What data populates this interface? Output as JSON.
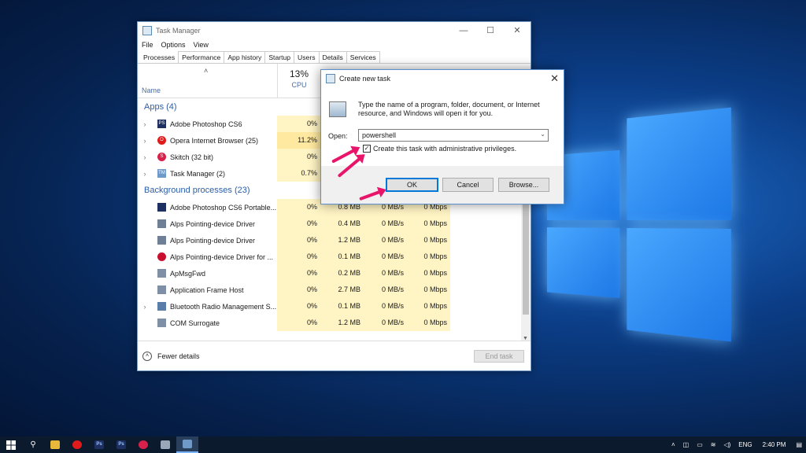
{
  "taskmanager": {
    "title": "Task Manager",
    "window_controls": [
      "—",
      "☐",
      "✕"
    ],
    "menu": [
      "File",
      "Options",
      "View"
    ],
    "tabs": [
      "Processes",
      "Performance",
      "App history",
      "Startup",
      "Users",
      "Details",
      "Services"
    ],
    "header": {
      "name": "Name",
      "cpu_pct": "13%",
      "cpu": "CPU"
    },
    "apps_group": "Apps (4)",
    "apps": [
      {
        "name": "Adobe Photoshop CS6",
        "cpu": "0%",
        "icon": "PS"
      },
      {
        "name": "Opera Internet Browser (25)",
        "cpu": "11.2%",
        "icon": "O"
      },
      {
        "name": "Skitch (32 bit)",
        "cpu": "0%",
        "icon": "S"
      },
      {
        "name": "Task Manager (2)",
        "cpu": "0.7%",
        "icon": "TM"
      }
    ],
    "bg_group": "Background processes (23)",
    "bg": [
      {
        "name": "Adobe Photoshop CS6 Portable...",
        "cpu": "0%",
        "mem": "0.8 MB",
        "disk": "0 MB/s",
        "net": "0 Mbps"
      },
      {
        "name": "Alps Pointing-device Driver",
        "cpu": "0%",
        "mem": "0.4 MB",
        "disk": "0 MB/s",
        "net": "0 Mbps"
      },
      {
        "name": "Alps Pointing-device Driver",
        "cpu": "0%",
        "mem": "1.2 MB",
        "disk": "0 MB/s",
        "net": "0 Mbps"
      },
      {
        "name": "Alps Pointing-device Driver for ...",
        "cpu": "0%",
        "mem": "0.1 MB",
        "disk": "0 MB/s",
        "net": "0 Mbps"
      },
      {
        "name": "ApMsgFwd",
        "cpu": "0%",
        "mem": "0.2 MB",
        "disk": "0 MB/s",
        "net": "0 Mbps"
      },
      {
        "name": "Application Frame Host",
        "cpu": "0%",
        "mem": "2.7 MB",
        "disk": "0 MB/s",
        "net": "0 Mbps"
      },
      {
        "name": "Bluetooth Radio Management S...",
        "cpu": "0%",
        "mem": "0.1 MB",
        "disk": "0 MB/s",
        "net": "0 Mbps"
      },
      {
        "name": "COM Surrogate",
        "cpu": "0%",
        "mem": "1.2 MB",
        "disk": "0 MB/s",
        "net": "0 Mbps"
      }
    ],
    "fewer_details": "Fewer details",
    "end_task": "End task"
  },
  "dialog": {
    "title": "Create new task",
    "description": "Type the name of a program, folder, document, or Internet resource, and Windows will open it for you.",
    "open_label": "Open:",
    "open_value": "powershell",
    "admin_checkbox": "Create this task with administrative privileges.",
    "ok": "OK",
    "cancel": "Cancel",
    "browse": "Browse..."
  },
  "taskbar": {
    "lang": "ENG",
    "time": "2:40 PM"
  },
  "colors": {
    "accent": "#0078d7",
    "annotation_arrow": "#e8156a",
    "cpu_highlight": "#fff4c4"
  }
}
